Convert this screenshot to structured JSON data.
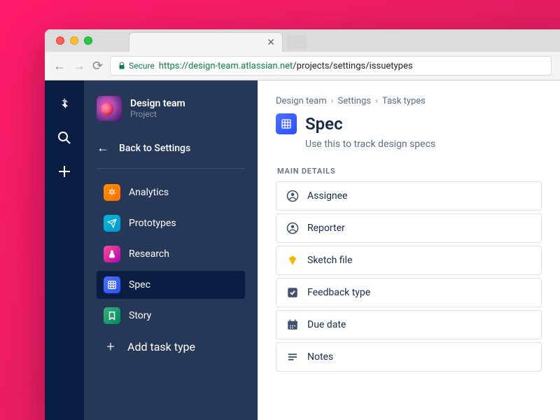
{
  "browser": {
    "secure_label": "Secure",
    "host": "design-team.atlassian.net",
    "url_prefix": "https://",
    "url_path": "/projects/settings/issuetypes"
  },
  "sidebar": {
    "project_name": "Design team",
    "project_sub": "Project",
    "back_label": "Back to Settings",
    "items": [
      {
        "label": "Analytics"
      },
      {
        "label": "Prototypes"
      },
      {
        "label": "Research"
      },
      {
        "label": "Spec"
      },
      {
        "label": "Story"
      }
    ],
    "add_label": "Add task type"
  },
  "main": {
    "breadcrumbs": [
      "Design team",
      "Settings",
      "Task types"
    ],
    "title": "Spec",
    "description": "Use this to track design specs",
    "section_label": "MAIN DETAILS",
    "fields": [
      {
        "label": "Assignee",
        "icon": "person"
      },
      {
        "label": "Reporter",
        "icon": "person"
      },
      {
        "label": "Sketch file",
        "icon": "sketch"
      },
      {
        "label": "Feedback type",
        "icon": "checkbox"
      },
      {
        "label": "Due date",
        "icon": "calendar"
      },
      {
        "label": "Notes",
        "icon": "notes"
      }
    ]
  }
}
